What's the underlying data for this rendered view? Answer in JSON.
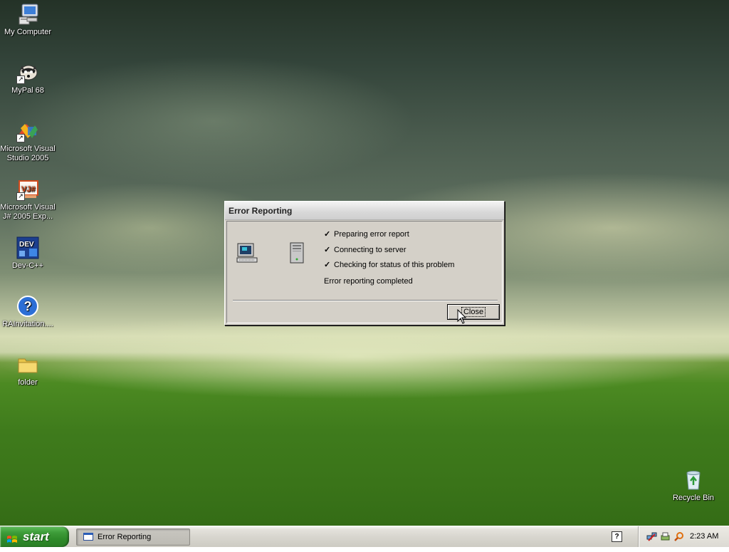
{
  "desktop": {
    "icons": [
      {
        "label": "My Computer",
        "icon": "computer-icon"
      },
      {
        "label": "MyPal 68",
        "icon": "raccoon-browser-icon"
      },
      {
        "label": "Microsoft Visual Studio 2005",
        "icon": "visual-studio-icon"
      },
      {
        "label": "Microsoft Visual J# 2005 Exp...",
        "icon": "visual-jsharp-icon"
      },
      {
        "label": "Dev-C++",
        "icon": "dev-cpp-icon"
      },
      {
        "label": "RAInvitation....",
        "icon": "help-question-icon"
      },
      {
        "label": "folder",
        "icon": "folder-icon"
      },
      {
        "label": "Recycle Bin",
        "icon": "recycle-bin-icon"
      }
    ],
    "dev_badge": "DEV",
    "vj_badge": "VJ#"
  },
  "dialog": {
    "title": "Error Reporting",
    "steps": [
      {
        "check": "✓",
        "text": "Preparing error report"
      },
      {
        "check": "✓",
        "text": "Connecting to server"
      },
      {
        "check": "✓",
        "text": "Checking for status of this problem"
      }
    ],
    "status": "Error reporting completed",
    "close_label": "Close",
    "icons": [
      "computer-icon",
      "server-icon"
    ]
  },
  "taskbar": {
    "start_label": "start",
    "tasks": [
      {
        "label": "Error Reporting",
        "icon": "window-icon"
      }
    ],
    "help_glyph": "?",
    "tray_icons": [
      "network-icon",
      "printer-icon",
      "search-icon"
    ],
    "clock": "2:23 AM"
  },
  "colors": {
    "start_green": "#3e9c39",
    "dialog_face": "#d4d0c8",
    "taskbar_face": "#d8d6cf"
  }
}
